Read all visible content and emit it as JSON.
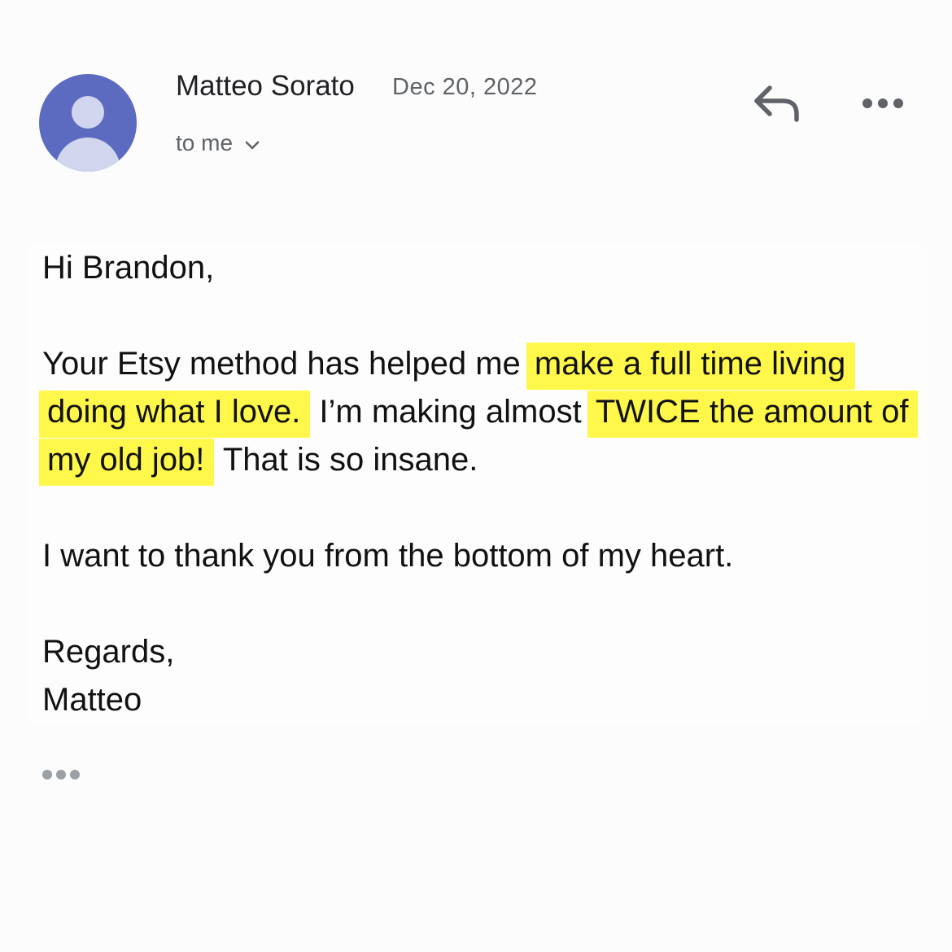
{
  "header": {
    "sender_name": "Matteo Sorato",
    "date": "Dec 20, 2022",
    "recipient_label": "to me",
    "avatar_bg": "#5c6bc0",
    "avatar_fg": "#d1d6ee"
  },
  "actions": {
    "reply_icon": "reply-arrow",
    "more_icon": "horizontal-ellipsis"
  },
  "body": {
    "greeting": "Hi Brandon,",
    "para1_part1": "Your Etsy method has helped me ",
    "para1_hl1": "make a full time living doing what I love.",
    "para1_part2": " I’m making almost ",
    "para1_hl2": "TWICE the amount of my old job!",
    "para1_part3": " That is so insane.",
    "para2": "I want to thank you from the bottom of my heart.",
    "closing": "Regards,",
    "signature": "Matteo",
    "highlight_color": "#fff84a"
  },
  "footer": {
    "trimmed_content_icon": "ellipsis"
  }
}
